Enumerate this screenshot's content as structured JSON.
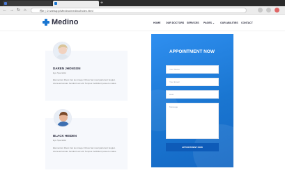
{
  "browser": {
    "tabs": [
      {
        "label": "",
        "active": false,
        "icon_color": "#4a7ad6"
      },
      {
        "label": "",
        "active": true,
        "icon_color": "#1a76d1"
      }
    ],
    "new_tab": "+",
    "url": "File | D:/webapp/Medino/medino/index.html"
  },
  "site": {
    "logo_text": "Medino",
    "nav": [
      "HOME",
      "OUR DOCTORS",
      "SERVICES",
      "PAGES ⌄",
      "OUR ABILITIES",
      "CONTACT"
    ]
  },
  "doctors": [
    {
      "name": "DAREN JHONSON",
      "role": "Eye Specialist",
      "desc": "Elementum libero hac leo integer. Risus hac road parturient feugiat. Litora accumsan hendrerit est elit. Tempus incididunt posuere malus."
    },
    {
      "name": "BLACK HEIDEN",
      "role": "Eye Specialist",
      "desc": "Elementum libero hac leo integer. Risus hac road parturient feugiat. Litora accumsan hendrerit est elit. Tempus incididunt posuere malus."
    }
  ],
  "appointment": {
    "title": "APPOINTMENT NOW",
    "name_placeholder": "Your Name",
    "email_placeholder": "Your Email",
    "date_placeholder": "Date",
    "message_placeholder": "Message",
    "button_label": "APPOINTMENT NOW"
  },
  "colors": {
    "brand": "#1a76d1",
    "dark": "#2c2d3f"
  }
}
